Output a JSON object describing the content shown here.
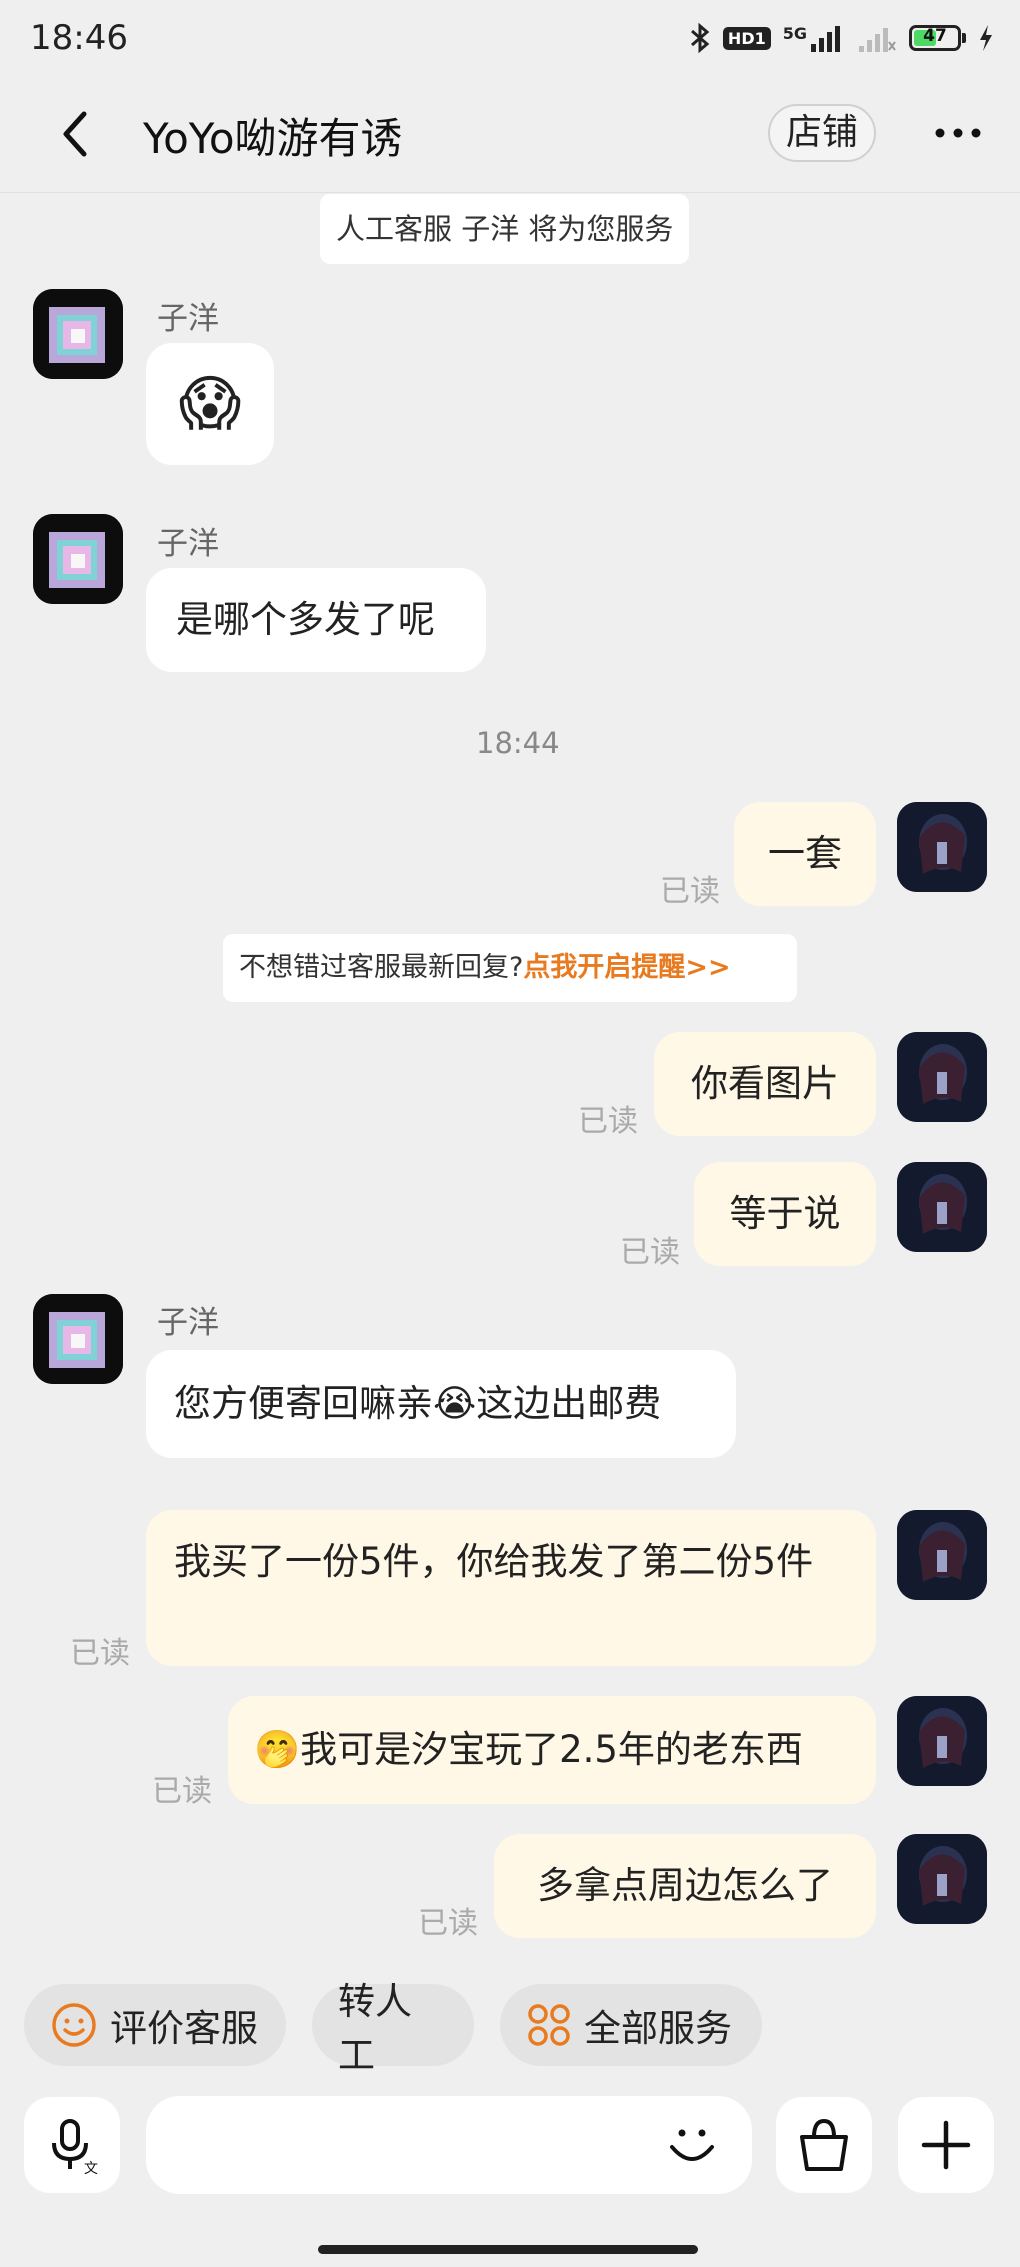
{
  "status_bar": {
    "time": "18:46",
    "hd_label": "HD1",
    "network": "5G",
    "battery_level": "47",
    "icons": [
      "bluetooth-icon",
      "signal-icon",
      "wifi-off-icon",
      "battery-icon",
      "charging-icon"
    ]
  },
  "header": {
    "title": "YoYo呦游有诱",
    "shop_label": "店铺"
  },
  "notice": {
    "text": "人工客服 子洋 将为您服务"
  },
  "messages": {
    "m1": {
      "sender": "子洋",
      "text": "😱"
    },
    "m2": {
      "sender": "子洋",
      "text": "是哪个多发了呢"
    },
    "time_sep": "18:44",
    "m3": {
      "text": "一套",
      "status": "已读"
    },
    "reminder": {
      "text": "不想错过客服最新回复?",
      "link": "点我开启提醒>>"
    },
    "m4": {
      "text": "你看图片",
      "status": "已读"
    },
    "m5": {
      "text": "等于说",
      "status": "已读"
    },
    "m6": {
      "sender": "子洋",
      "text": "您方便寄回嘛亲😭这边出邮费"
    },
    "m7": {
      "text": "我买了一份5件，你给我发了第二份5件",
      "status": "已读"
    },
    "m8": {
      "text": "🤭我可是汐宝玩了2.5年的老东西",
      "status": "已读"
    },
    "m9": {
      "text": "多拿点周边怎么了",
      "status": "已读"
    }
  },
  "quick_actions": {
    "rate": "评价客服",
    "human": "转人工",
    "all_services": "全部服务"
  },
  "input_bar": {
    "value": ""
  },
  "colors": {
    "background": "#efefef",
    "my_bubble": "#fff8e7",
    "accent": "#e87a1f"
  }
}
